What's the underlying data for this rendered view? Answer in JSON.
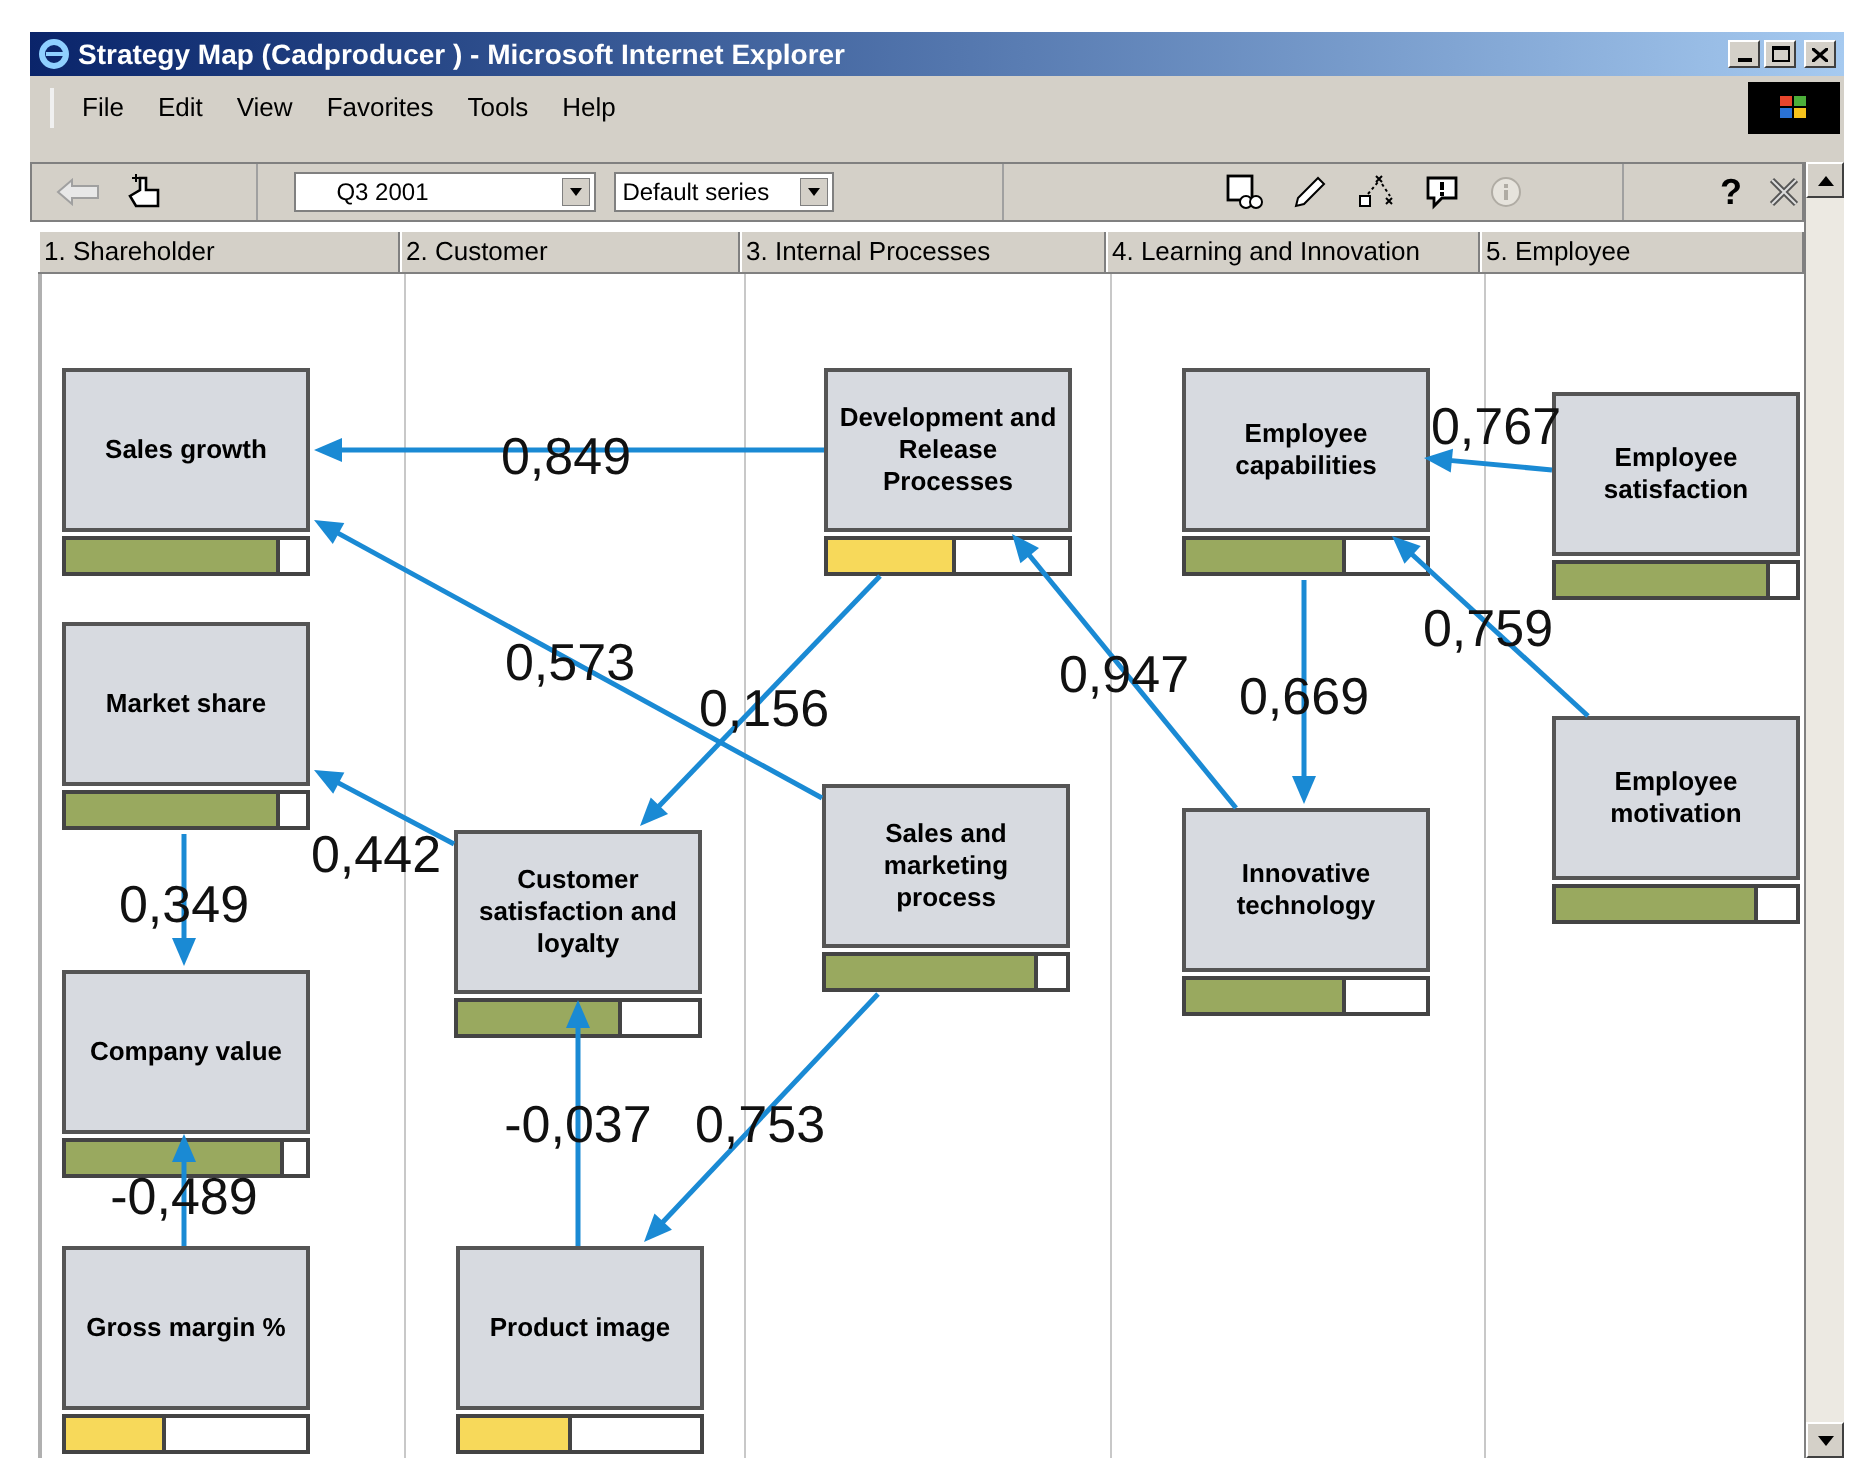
{
  "window": {
    "title": "Strategy Map (Cadproducer ) - Microsoft Internet Explorer"
  },
  "menu": [
    "File",
    "Edit",
    "View",
    "Favorites",
    "Tools",
    "Help"
  ],
  "toolbar": {
    "period": "Q3 2001",
    "series": "Default series",
    "help": "?"
  },
  "columns": [
    "1. Shareholder",
    "2. Customer",
    "3. Internal Processes",
    "4. Learning and Innovation",
    "5. Employee"
  ],
  "nodes": [
    {
      "label": "Sales growth",
      "level": 0.89,
      "color": "#99a95f"
    },
    {
      "label": "Market share",
      "level": 0.89,
      "color": "#99a95f"
    },
    {
      "label": "Company value",
      "level": 0.91,
      "color": "#99a95f"
    },
    {
      "label": "Gross margin %",
      "level": 0.42,
      "color": "#f7d95a"
    },
    {
      "label": "Customer satisfaction and loyalty",
      "level": 0.68,
      "color": "#99a95f"
    },
    {
      "label": "Product image",
      "level": 0.47,
      "color": "#f7d95a"
    },
    {
      "label": "Development and Release Processes",
      "level": 0.53,
      "color": "#f7d95a"
    },
    {
      "label": "Sales and marketing process",
      "level": 0.88,
      "color": "#99a95f"
    },
    {
      "label": "Employee capabilities",
      "level": 0.67,
      "color": "#99a95f"
    },
    {
      "label": "Innovative technology",
      "level": 0.67,
      "color": "#99a95f"
    },
    {
      "label": "Employee satisfaction",
      "level": 0.89,
      "color": "#99a95f"
    },
    {
      "label": "Employee motivation",
      "level": 0.84,
      "color": "#99a95f"
    }
  ],
  "links": [
    {
      "label": "0,849"
    },
    {
      "label": "0,573"
    },
    {
      "label": "0,156"
    },
    {
      "label": "0,442"
    },
    {
      "label": "0,349"
    },
    {
      "label": "-0,489"
    },
    {
      "label": "-0,037"
    },
    {
      "label": "0,753"
    },
    {
      "label": "0,947"
    },
    {
      "label": "0,669"
    },
    {
      "label": "0,767"
    },
    {
      "label": "0,759"
    }
  ]
}
